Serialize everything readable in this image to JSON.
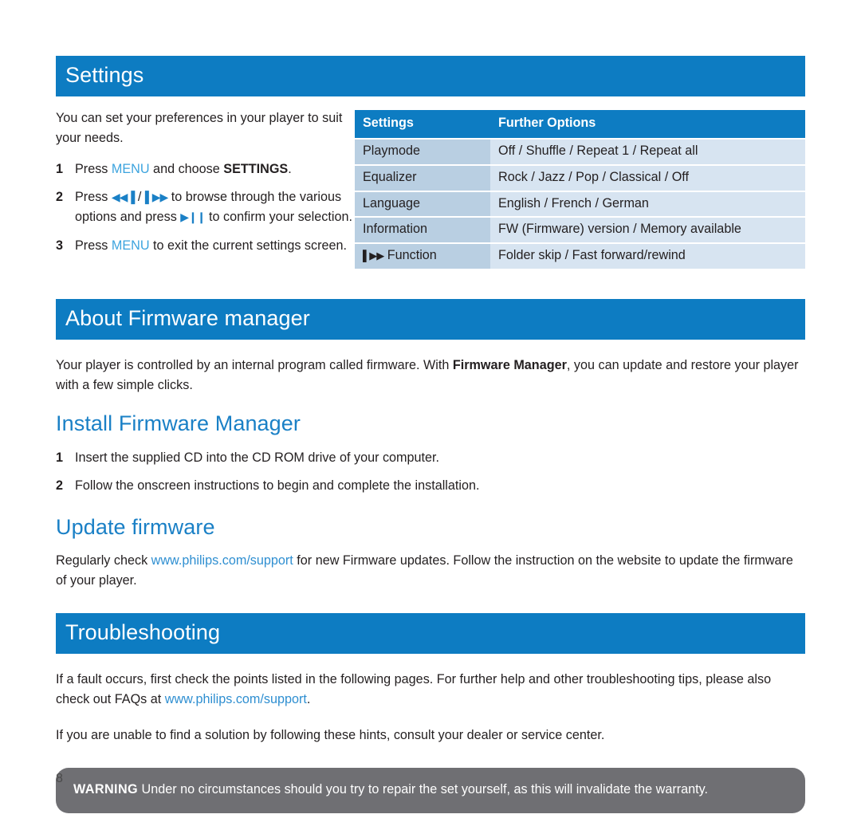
{
  "document": {
    "page_number": "8",
    "accent_blue": "#0d7cc2",
    "heading_blue": "#1a80c6",
    "link_blue": "#2f8fd1",
    "menu_blue": "#3ba3de",
    "table_col1_bg": "#b9cfe2",
    "table_col2_bg": "#d7e4f1",
    "warning_bg": "#6f6f73"
  },
  "settings_section": {
    "banner_title": "Settings",
    "intro": "You can set your preferences in your player to suit your needs.",
    "steps": [
      {
        "num": "1",
        "prefix": "Press ",
        "menu": "MENU",
        "mid": " and choose ",
        "bold": "SETTINGS",
        "suffix": "."
      },
      {
        "num": "2",
        "prefix": "Press ",
        "glyph_prev": "◀◀▐",
        "sep": " / ",
        "glyph_next": "▌▶▶",
        "mid": " to browse through the various options and press ",
        "glyph_play": "▶❙❙",
        "suffix": " to confirm your selection."
      },
      {
        "num": "3",
        "prefix": "Press ",
        "menu": "MENU",
        "suffix": " to exit the current settings screen."
      }
    ],
    "table": {
      "headers": [
        "Settings",
        "Further Options"
      ],
      "rows": [
        [
          "Playmode",
          "Off / Shuffle / Repeat 1 / Repeat all"
        ],
        [
          "Equalizer",
          "Rock / Jazz / Pop / Classical / Off"
        ],
        [
          "Language",
          "English / French / German"
        ],
        [
          "Information",
          "FW (Firmware) version / Memory available"
        ],
        [
          "▌▶▶ Function",
          "Folder skip / Fast forward/rewind"
        ]
      ],
      "row_glyph_prefix": "▌▶▶",
      "row_glyph_label": " Function"
    }
  },
  "firmware_section": {
    "banner_title": "About Firmware manager",
    "intro_a": "Your player is controlled by an internal program called firmware. With ",
    "intro_bold": "Firmware Manager",
    "intro_b": ", you can update and restore your player with a few simple clicks.",
    "install_heading": "Install Firmware Manager",
    "install_steps": [
      {
        "num": "1",
        "text": "Insert the supplied CD into the CD ROM drive of your computer."
      },
      {
        "num": "2",
        "text": "Follow the onscreen instructions to begin and complete the installation."
      }
    ],
    "update_heading": "Update firmware",
    "update_a": "Regularly check ",
    "update_link": "www.philips.com/support",
    "update_b": " for new Firmware updates. Follow the instruction on the website to update the firmware of your player."
  },
  "troubleshooting_section": {
    "banner_title": "Troubleshooting",
    "para1_a": "If a fault occurs, first check the points listed in the following pages. For further help and other troubleshooting tips, please also check out FAQs at ",
    "para1_link": "www.philips.com/support",
    "para1_b": ".",
    "para2": "If you are unable to find a solution by following these hints, consult your dealer or service center.",
    "warning_label": "WARNING",
    "warning_text": " Under no circumstances should you try to repair the set yourself, as this will invalidate the warranty."
  }
}
